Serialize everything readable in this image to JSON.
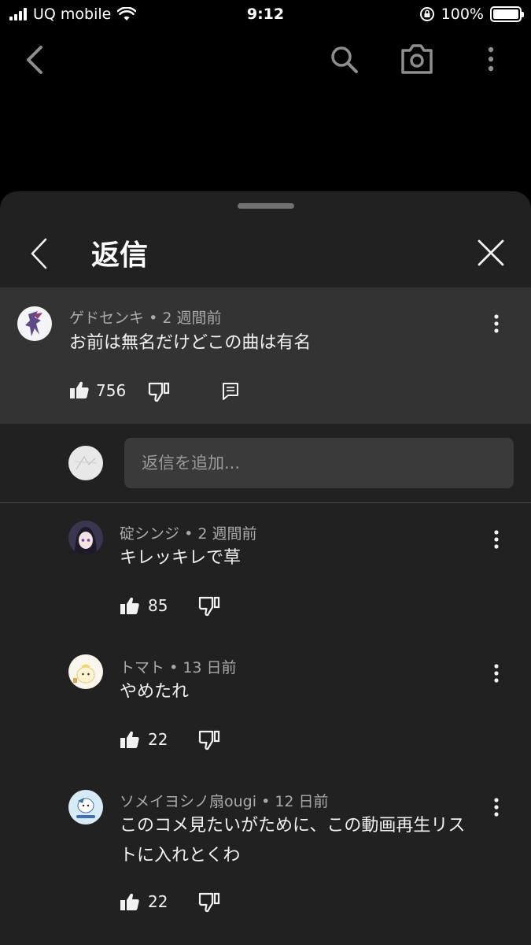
{
  "status_bar": {
    "carrier": "UQ mobile",
    "time": "9:12",
    "battery": "100%",
    "battery_level": 1.0
  },
  "appbar": {
    "icons": [
      "back-arrow-icon",
      "search-icon",
      "camera-icon",
      "more-vert-icon"
    ]
  },
  "sheet": {
    "title": "返信"
  },
  "parent_comment": {
    "author": "ゲドセンキ",
    "age": "2 週間前",
    "text": "お前は無名だけどこの曲は有名",
    "likes": "756"
  },
  "reply_box": {
    "placeholder": "返信を追加..."
  },
  "replies": [
    {
      "author": "碇シンジ",
      "age": "2 週間前",
      "text": "キレッキレで草",
      "likes": "85"
    },
    {
      "author": "トマト",
      "age": "13 日前",
      "text": "やめたれ",
      "likes": "22"
    },
    {
      "author": "ソメイヨシノ扇ougi",
      "age": "12 日前",
      "text_line1": "このコメ見たいがために、この動画再生リス",
      "text_line2": "トに入れとくわ",
      "likes": "22"
    }
  ],
  "separator": "•",
  "colors": {
    "background": "#000000",
    "sheet": "#212121",
    "highlight": "#333333",
    "secondary_text": "#aaaaaa"
  }
}
